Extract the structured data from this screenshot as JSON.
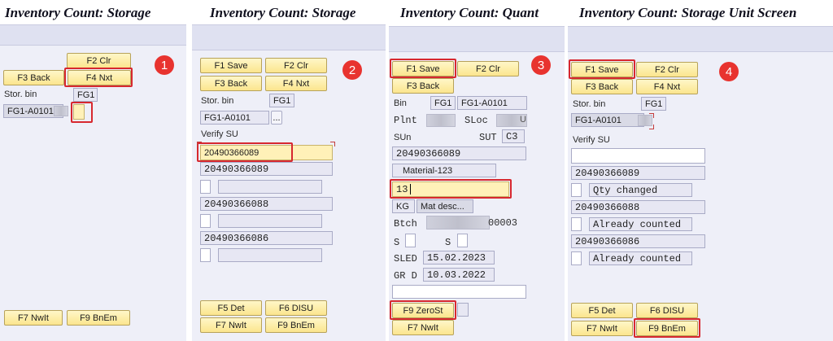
{
  "panel1": {
    "title": "Inventory Count: Storage",
    "f2_clr": "F2 Clr",
    "f3_back": "F3 Back",
    "f4_nxt": "F4 Nxt",
    "stor_bin_label": "Stor. bin",
    "stor_bin_value": "FG1",
    "bin_value": "FG1-A0101",
    "f7_nwit": "F7 NwIt",
    "f9_bnem": "F9 BnEm",
    "badge": "1"
  },
  "panel2": {
    "title": "Inventory Count: Storage",
    "f1_save": "F1 Save",
    "f2_clr": "F2 Clr",
    "f3_back": "F3 Back",
    "f4_nxt": "F4 Nxt",
    "stor_bin_label": "Stor. bin",
    "stor_bin_value": "FG1",
    "bin_value": "FG1-A0101",
    "more_button": "...",
    "verify_su_label": "Verify SU",
    "verify_su_value": "20490366089",
    "su_list": [
      "20490366089",
      "20490366088",
      "20490366086"
    ],
    "f5_det": "F5 Det",
    "f6_disu": "F6 DISU",
    "f7_nwit": "F7 NwIt",
    "f9_bnem": "F9 BnEm",
    "badge": "2"
  },
  "panel3": {
    "title": "Inventory Count: Quant",
    "f1_save": "F1 Save",
    "f2_clr": "F2 Clr",
    "f3_back": "F3 Back",
    "bin_label": "Bin",
    "bin_code": "FG1",
    "bin_value": "FG1-A0101",
    "plnt_label": "Plnt",
    "sloc_label": "SLoc",
    "sloc_suffix": "U",
    "sun_label": "SUn",
    "sut_label": "SUT",
    "sut_value": "C3",
    "sun_value": "20490366089",
    "material": "Material-123",
    "qty_value": "13",
    "uom": "KG",
    "mat_desc": "Mat desc...",
    "btch_label": "Btch",
    "btch_suffix": "00003",
    "s_label_1": "S",
    "s_label_2": "S",
    "sled_label": "SLED",
    "sled_value": "15.02.2023",
    "grd_label": "GR D",
    "grd_value": "10.03.2022",
    "f9_zerost": "F9 ZeroSt",
    "f7_nwit": "F7 NwIt",
    "badge": "3"
  },
  "panel4": {
    "title": "Inventory Count: Storage Unit Screen",
    "f1_save": "F1 Save",
    "f2_clr": "F2 Clr",
    "f3_back": "F3 Back",
    "f4_nxt": "F4 Nxt",
    "stor_bin_label": "Stor. bin",
    "stor_bin_value": "FG1",
    "bin_value": "FG1-A0101",
    "verify_su_label": "Verify SU",
    "su_list": [
      {
        "su": "20490366089",
        "status": "Qty changed"
      },
      {
        "su": "20490366088",
        "status": "Already counted"
      },
      {
        "su": "20490366086",
        "status": "Already counted"
      }
    ],
    "f5_det": "F5 Det",
    "f6_disu": "F6 DISU",
    "f7_nwit": "F7 NwIt",
    "f9_bnem": "F9 BnEm",
    "badge": "4"
  },
  "colors": {
    "highlight": "#d7282f",
    "badge": "#e8332f",
    "button": "#fbe58e",
    "panel_bg": "#eeeff8"
  }
}
